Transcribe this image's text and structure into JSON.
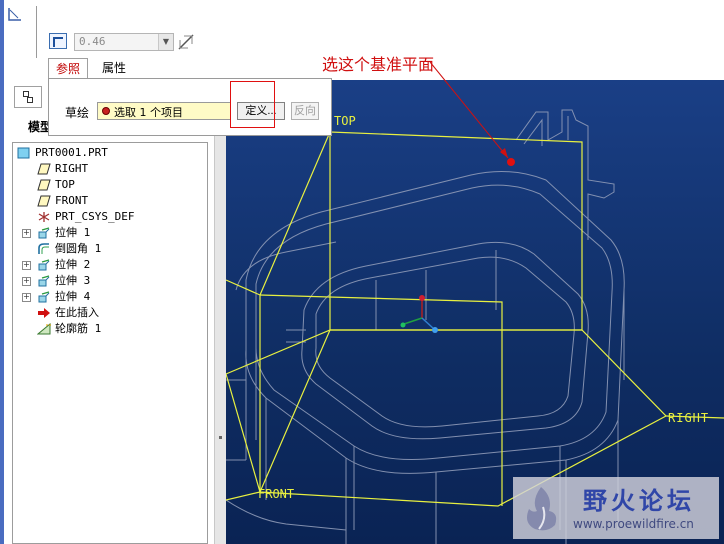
{
  "toolbar": {
    "thickness_value": "0.46",
    "tabs": [
      {
        "label": "参照"
      },
      {
        "label": "属性"
      }
    ]
  },
  "references_panel": {
    "sketch_label": "草绘",
    "collector_text": "选取 1 个项目",
    "define_button": "定义...",
    "flip_button": "反向"
  },
  "navigator": {
    "title": "模型",
    "tree": [
      {
        "label": "PRT0001.PRT",
        "icon": "part-icon",
        "expandable": false
      },
      {
        "label": "RIGHT",
        "icon": "datum-plane-icon",
        "expandable": false
      },
      {
        "label": "TOP",
        "icon": "datum-plane-icon",
        "expandable": false
      },
      {
        "label": "FRONT",
        "icon": "datum-plane-icon",
        "expandable": false
      },
      {
        "label": "PRT_CSYS_DEF",
        "icon": "csys-icon",
        "expandable": false
      },
      {
        "label": "拉伸 1",
        "icon": "extrude-icon",
        "expandable": true
      },
      {
        "label": "倒圆角 1",
        "icon": "round-icon",
        "expandable": false
      },
      {
        "label": "拉伸 2",
        "icon": "extrude-icon",
        "expandable": true
      },
      {
        "label": "拉伸 3",
        "icon": "extrude-icon",
        "expandable": true
      },
      {
        "label": "拉伸 4",
        "icon": "extrude-icon",
        "expandable": true
      },
      {
        "label": "在此插入",
        "icon": "insert-here-icon",
        "expandable": false
      },
      {
        "label": "轮廓筋 1",
        "icon": "rib-icon",
        "expandable": false
      }
    ]
  },
  "viewport": {
    "plane_labels": {
      "top": "TOP",
      "right": "RIGHT",
      "front": "FRONT"
    },
    "plane_color": "#e8f040",
    "background": "#123472"
  },
  "annotation": {
    "text": "选这个基准平面",
    "color": "#d01010"
  },
  "watermark": {
    "title": "野火论坛",
    "url": "www.proewildfire.cn"
  }
}
